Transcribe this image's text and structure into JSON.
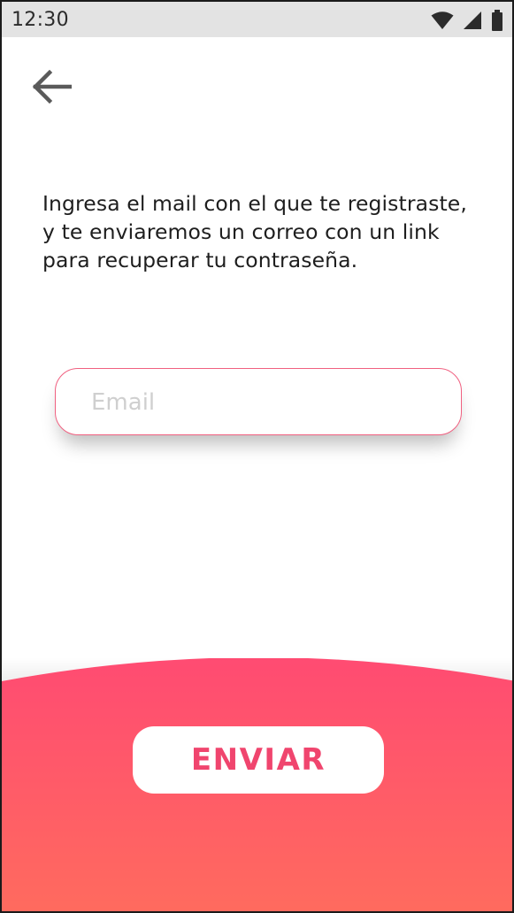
{
  "status_bar": {
    "time": "12:30",
    "icons": [
      "wifi-icon",
      "signal-icon",
      "battery-icon"
    ]
  },
  "header": {
    "back_icon": "arrow-left-icon"
  },
  "main": {
    "instructions": "Ingresa el mail con el que te registraste, y te enviaremos un correo con un link para recuperar tu contraseña.",
    "email_field": {
      "placeholder": "Email",
      "value": ""
    }
  },
  "footer": {
    "send_label": "ENVIAR"
  },
  "colors": {
    "accent": "#f0456e",
    "gradient_top": "#ff4b72",
    "gradient_bottom": "#ff6b5e",
    "status_bar": "#e3e3e3"
  }
}
